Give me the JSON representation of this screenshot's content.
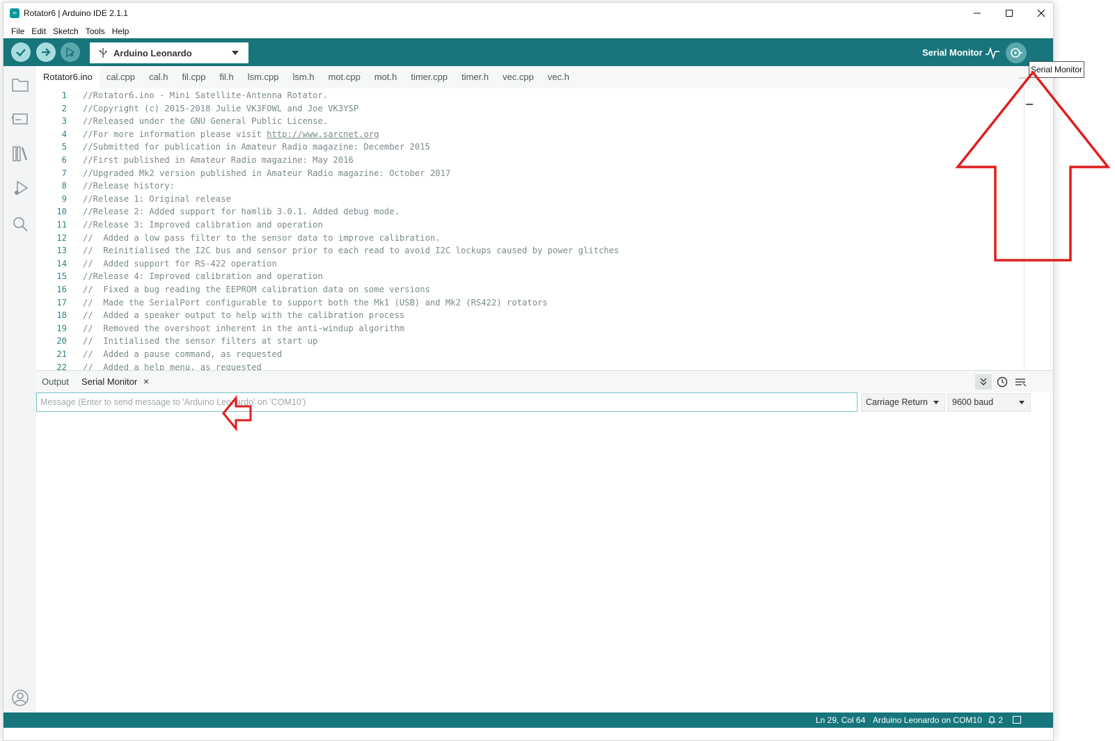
{
  "window": {
    "title": "Rotator6 | Arduino IDE 2.1.1",
    "logo_text": "∞"
  },
  "menu": [
    "File",
    "Edit",
    "Sketch",
    "Tools",
    "Help"
  ],
  "toolbar": {
    "board": "Arduino Leonardo",
    "serial_monitor_label": "Serial Monitor"
  },
  "tabs": [
    {
      "label": "Rotator6.ino",
      "active": true
    },
    {
      "label": "cal.cpp"
    },
    {
      "label": "cal.h"
    },
    {
      "label": "fil.cpp"
    },
    {
      "label": "fil.h"
    },
    {
      "label": "lsm.cpp"
    },
    {
      "label": "lsm.h"
    },
    {
      "label": "mot.cpp"
    },
    {
      "label": "mot.h"
    },
    {
      "label": "timer.cpp"
    },
    {
      "label": "timer.h"
    },
    {
      "label": "vec.cpp"
    },
    {
      "label": "vec.h"
    }
  ],
  "tab_more": "...",
  "code_lines": [
    {
      "n": "1",
      "text": "//Rotator6.ino - Mini Satellite-Antenna Rotator."
    },
    {
      "n": "2",
      "text": "//Copyright (c) 2015-2018 Julie VK3FOWL and Joe VK3YSP"
    },
    {
      "n": "3",
      "text": "//Released under the GNU General Public License."
    },
    {
      "n": "4",
      "text": "//For more information please visit ",
      "link": "http://www.sarcnet.org"
    },
    {
      "n": "5",
      "text": "//Submitted for publication in Amateur Radio magazine: December 2015"
    },
    {
      "n": "6",
      "text": "//First published in Amateur Radio magazine: May 2016"
    },
    {
      "n": "7",
      "text": "//Upgraded Mk2 version published in Amateur Radio magazine: October 2017"
    },
    {
      "n": "8",
      "text": "//Release history:"
    },
    {
      "n": "9",
      "text": "//Release 1: Original release"
    },
    {
      "n": "10",
      "text": "//Release 2: Added support for hamlib 3.0.1. Added debug mode."
    },
    {
      "n": "11",
      "text": "//Release 3: Improved calibration and operation"
    },
    {
      "n": "12",
      "text": "//  Added a low pass filter to the sensor data to improve calibration."
    },
    {
      "n": "13",
      "text": "//  Reinitialised the I2C bus and sensor prior to each read to avoid I2C lockups caused by power glitches"
    },
    {
      "n": "14",
      "text": "//  Added support for RS-422 operation"
    },
    {
      "n": "15",
      "text": "//Release 4: Improved calibration and operation"
    },
    {
      "n": "16",
      "text": "//  Fixed a bug reading the EEPROM calibration data on some versions"
    },
    {
      "n": "17",
      "text": "//  Made the SerialPort configurable to support both the Mk1 (USB) and Mk2 (RS422) rotators"
    },
    {
      "n": "18",
      "text": "//  Added a speaker output to help with the calibration process"
    },
    {
      "n": "19",
      "text": "//  Removed the overshoot inherent in the anti-windup algorithm"
    },
    {
      "n": "20",
      "text": "//  Initialised the sensor filters at start up"
    },
    {
      "n": "21",
      "text": "//  Added a pause command, as requested"
    },
    {
      "n": "22",
      "text": "//  Added a help menu, as requested"
    }
  ],
  "panel": {
    "tab_output": "Output",
    "tab_serial": "Serial Monitor",
    "close_glyph": "×",
    "message_placeholder": "Message (Enter to send message to 'Arduino Leonardo' on 'COM10')",
    "line_ending": "Carriage Return",
    "baud": "9600 baud"
  },
  "status": {
    "cursor": "Ln 29, Col 64",
    "board_port": "Arduino Leonardo on COM10",
    "notifications": "2"
  },
  "tooltip": "Serial Monitor",
  "colors": {
    "teal": "#17757b",
    "annotation_red": "#e01e1e"
  }
}
